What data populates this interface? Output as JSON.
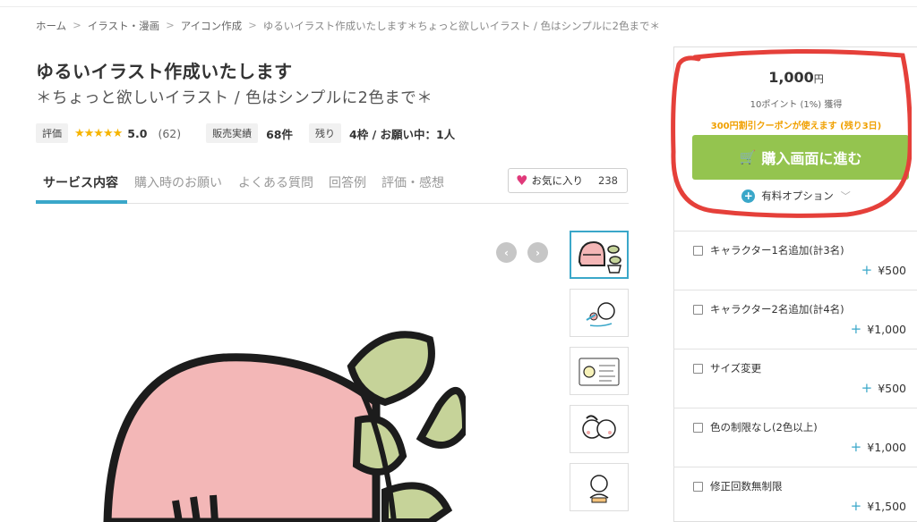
{
  "breadcrumb": {
    "items": [
      "ホーム",
      "イラスト・漫画",
      "アイコン作成",
      "ゆるいイラスト作成いたします＊ちょっと欲しいイラスト / 色はシンプルに2色まで＊"
    ],
    "separator": ">"
  },
  "service": {
    "title": "ゆるいイラスト作成いたします",
    "subtitle": "＊ちょっと欲しいイラスト / 色はシンプルに2色まで＊"
  },
  "meta": {
    "rating_label": "評価",
    "stars": "★★★★★",
    "rating_value": "5.0",
    "rating_count": "(62)",
    "sales_label": "販売実績",
    "sales_value": "68件",
    "remaining_label": "残り",
    "remaining_value": "4枠 / お願い中：1人"
  },
  "tabs": [
    {
      "label": "サービス内容",
      "active": true
    },
    {
      "label": "購入時のお願い",
      "active": false
    },
    {
      "label": "よくある質問",
      "active": false
    },
    {
      "label": "回答例",
      "active": false
    },
    {
      "label": "評価・感想",
      "active": false
    }
  ],
  "favorite": {
    "label": "お気に入り",
    "count": "238",
    "icon": "heart-icon"
  },
  "gallery": {
    "prev_icon": "chevron-left-icon",
    "next_icon": "chevron-right-icon",
    "prev_glyph": "‹",
    "next_glyph": "›"
  },
  "purchase": {
    "price": "1,000",
    "currency": "円",
    "points": "10ポイント (1%) 獲得",
    "coupon": "300円割引クーポンが使えます (残り3日)",
    "buy_label": "購入画面に進む",
    "buy_icon": "cart-icon",
    "options_link": "有料オプション",
    "accent_color": "#94c44f",
    "highlight_color": "#e5403a"
  },
  "options": [
    {
      "label": "キャラクター1名追加(計3名)",
      "price": "¥500"
    },
    {
      "label": "キャラクター2名追加(計4名)",
      "price": "¥1,000"
    },
    {
      "label": "サイズ変更",
      "price": "¥500"
    },
    {
      "label": "色の制限なし(2色以上)",
      "price": "¥1,000"
    },
    {
      "label": "修正回数無制限",
      "price": "¥1,500"
    }
  ]
}
